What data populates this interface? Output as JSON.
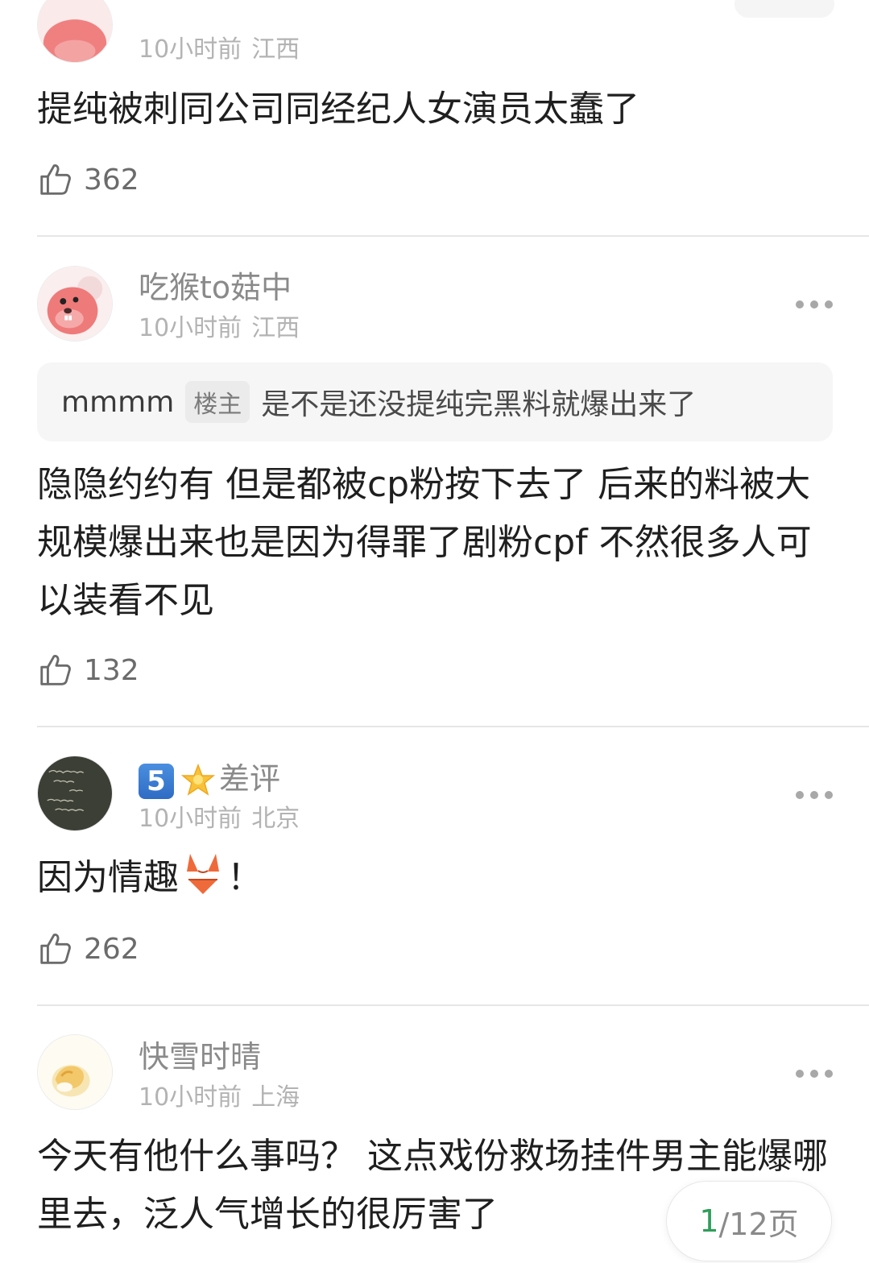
{
  "comments": [
    {
      "meta": {
        "time": "10小时前",
        "location": "江西"
      },
      "content": "提纯被刺同公司同经纪人女演员太蠢了",
      "likes": "362"
    },
    {
      "username": "吃猴to菇中",
      "meta": {
        "time": "10小时前",
        "location": "江西"
      },
      "quote": {
        "user": "mmmm",
        "badge": "楼主",
        "text": "是不是还没提纯完黑料就爆出来了"
      },
      "content": "隐隐约约有  但是都被cp粉按下去了  后来的料被大规模爆出来也是因为得罪了剧粉cpf  不然很多人可以装看不见",
      "likes": "132"
    },
    {
      "level": "5",
      "username": "差评",
      "meta": {
        "time": "10小时前",
        "location": "北京"
      },
      "content_before": "因为情趣",
      "content_after": "！",
      "content_emoji": "bikini-emoji",
      "likes": "262"
    },
    {
      "username": "快雪时晴",
      "meta": {
        "time": "10小时前",
        "location": "上海"
      },
      "content": "今天有他什么事吗？ 这点戏份救场挂件男主能爆哪里去，泛人气增长的很厉害了"
    }
  ],
  "pagination": {
    "current": "1",
    "total": "/12页"
  },
  "icons": {
    "like": "thumbs-up-icon",
    "more": "more-dots-icon",
    "star": "star-icon"
  },
  "colors": {
    "page_current": "#2f9e5a",
    "level_badge": "#2f6cc4"
  }
}
